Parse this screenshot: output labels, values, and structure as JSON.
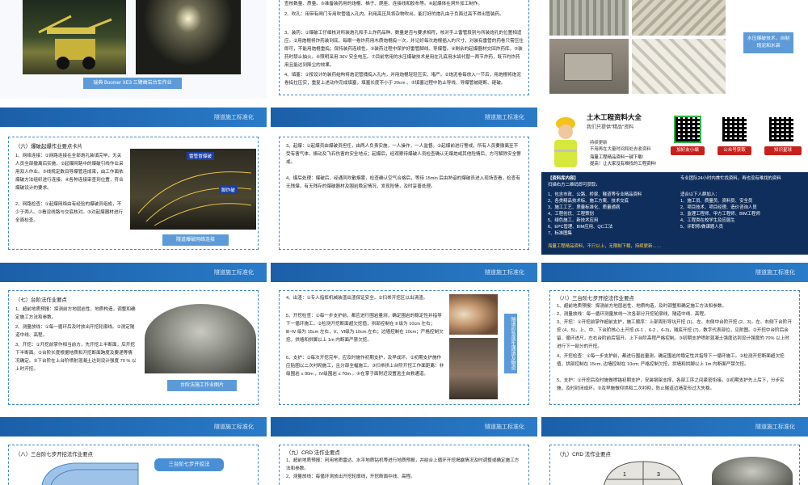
{
  "brand": "隧道施工标准化",
  "brand_short": "化",
  "row1": {
    "s1_caption": "瑞典 Boomer XE3 三臂凿岩台车作业",
    "s2_text": [
      "查核数量、质量。③准备装药用的炮棍、梯子、爬座、连接线和胶布等。④起爆体在洞外加工制作。",
      "2、吹孔：用带有闸门专用吹管插入孔内，利用高压风将杂物吹出，能打好的炮孔由于负面过高不得出管装药。",
      "3、装药：①爆破工仔细核对所装炮孔和手上炸药品种、数量是否与要求相符，核对手上雷管段别与所装炮孔的位置相适应。②用炮棍将炸药装到底，每眼一卷炸药用木质炮棍捣一次，并记好每次炮棍插入的尺寸，对装有雷管的药卷只需压住即可，不能用炮棍重捣；保持装药连续性。③装药过程中保护好雷管脚线、导爆管。④剩余的起爆器材交回炸药库。⑤装药时禁止抽火。⑥照明采用 36V 安全电压。⑦目前常用的水压爆破技术是用在孔底用水袋代替一两节炸药，既节约炸药用且能达到降尘的效果。",
      "4、填塞：①按设计的装药结构将炮泥管捅捣入孔内，并用炮棍轻轻压实、堵严。②炮泥卷每放入一节后，用炮棍将炮泥卷捣拉压实，重复上述动作完成填塞，填塞长度不小于 20cm 。③填塞过程中防止导线、导爆管被砸断、砸破。"
    ],
    "s3_side_caption": "水压爆破技术，自制炮泥和水袋"
  },
  "row2": {
    "s1_heading": "（六）爆破起爆作业要点卡片",
    "s1_text": [
      "1、网络连接：①网路连接在全部炮孔装填完毕，无关人员全部撤离后实施。②起爆网路中的爆破引线作业采用双人作业。③线规定数目导爆管连成束，由工作面依爆破方法组织进行连接。④各种连接审查到位置，符合爆破设计的要求。",
      "2、网路检查：①起爆网络由有经验的爆破员组成，不少于两人。②看设线路与交底核对。③对起爆器材进行全面检查。"
    ],
    "s1_photo_labels": [
      "雷管冒爆破",
      "脚炸破"
    ],
    "s1_caption": "隧道爆破网络连接",
    "s2_text": [
      "3、起爆：①起爆员由爆破员担任，由两人负责实施，一人操作，一人监督。②起爆前进行警戒，所有人员要撤离至不受有害气体、振动及飞石伤害的安全地点；起爆后，经观察待爆破人员检查确认无爆炮或其他险情后，方可解除安全警戒。",
      "4、爆后处理：爆破后，经通风吹散烟雾，检查确认空气合格后，等待 15min 后由熟谙的爆破员进入现场查看，检查有无残爆，有无残存的爆破器材及围岩稳定情况，发现险情，及时妥善处理。"
    ],
    "ad": {
      "title": "土木工程资料大全",
      "subtitle": "我们只提供\"精品\"资料",
      "lines": [
        "持续更新",
        "不用再在大量时间和处去收资料"
      ],
      "promo": [
        "海量工程精品资料一键下载!",
        "提高！让大家没有难找的工程资料!"
      ],
      "btns": [
        "立即扫码\n关注小编",
        "立即扫码\n领取资料",
        "立即扫码加入\n知识星球获取"
      ],
      "btn_sub": [
        "加好友小编",
        "公众号获取",
        "知识星球"
      ],
      "panel_left_title": "【资料库内容】",
      "panel_left_sub": "扫描右方二维码即可获取↓",
      "panel_left_items": [
        "1、包含市政、公路、桥梁、隧道等专业精品资料",
        "2、各类精品技术标、施工方案、技术交底",
        "3、施工工艺、质量标准化、质量通病",
        "4、工程创优、工程策划",
        "5、绿色施工、新技术应用",
        "6、EPC管理、BIM应用、QC工法",
        "7、标准图集"
      ],
      "panel_right_title": "专业团队24小时内首忙找资料，再也没有难找的资料",
      "panel_right_sub": "适合以下人群加入：",
      "panel_right_items": [
        "1、施工员、质量员、资料员、安全员",
        "2、项目技术、项目经理、造价咨询人员",
        "3、监理工程师、甲方工程师、BIM工程师",
        "4、工程类在校学生及应届生",
        "5、评职称/做课题人员"
      ],
      "footer": "海量工程精品资料，不只以上，无限制下载，持续更新……"
    }
  },
  "row3": {
    "s1_heading": "（七）台阶法作业要点",
    "s1_text": [
      "1、超前地质预报：探测前方地层岩性、地质构造，调整和确定施工方法和参数。",
      "2、测量放线：①每一循环后及时放出开挖轮廓线。②测定隧道中线、高程。",
      "3、开挖：①开挖前掌作相当前方，先开挖上半断面，后开挖下半断面。②台阶长度根据地质和开挖断面跨度及要递等情况确定。③下台阶在上台阶喷射混凝土达到设计强度 70 % 以上时开挖。"
    ],
    "s1_caption": "台阶法施工作业图片",
    "s2_text": [
      "4、出渣：①专人指挥机械装渣出渣保证安全。②扫帚开挖区以出清渣。",
      "5、开挖检查：①每一步支护前，都应进行围岩量测，确定围岩的稳定性并指导下一循环施工。②检测开挖断面超欠挖值，拱部控制在 Ⅱ 级为 10cm 左右；Ⅲ~Ⅳ 级为 15cm 左右，Ⅴ、Ⅵ级为 10cm 左右；边墙控制在 10cm；严格控制欠挖，拱墙和拱脚以上 1m 内断面严禁欠挖。",
      "6、支护：①每次开挖完毕，应及时施作初期支护，及早成环。②初期支护施作应贴圈以二次衬砌施工，且分部全幅施工。③扫帚拱上台阶开挖工作面距离：非级围岩 ≤ 90m ，Ⅳ级围岩 ≤ 70m 。④在掌子面附近设置逃生自救通道。"
    ],
    "s2_side_caption": "隧道应急逃生通道及物资",
    "s3_heading": "（八）三台阶七步开挖法作业要点",
    "s3_text": [
      "1、超前地质预报：探测前方地层岩性、地质构造，及时调整和确定施工方法和参数。",
      "2、测量放线：每一循环测量放线一次各部分开挖轮廓线、隧道中线、高程。",
      "3、开挖：①开挖前掌作超前支护，施工顺序：上部周形导坑开挖 (1)、左、右侧中台阶开挖 (2、3)，左、右侧下台阶开挖 (4、5)，上、中、下台阶核心土开挖 (6-1 、6-2 、6-3)，隧底开挖 (7)，数字代表部位，见附图。②开挖中台阶后余留、循环进尺，左右台阶前后错开。上下台阶高程严格控制。③初期支护喷射混凝土强度达到设计强度的 70% 以上时进行下一部分的开挖。",
      "4、开挖检查：①每一步支护前，都进行围岩量测，确定围岩的稳定性并指导下一循环施工。②检测开挖断面超欠挖值，拱部控制在 15cm, 边墙控制在 10cm; 严格控制欠挖，拱墙和拱脚以上 1m 内断面严禁欠挖。",
      "5、支护：①开挖后及时施做喷锚初期支护，安装钢架支撑，各部工序之间紧密衔接。②初期支护先上后下，分步实施，及时封闭成环。③及早施做仰拱和二次衬砌，防止隧道边墙变形过大失稳。"
    ]
  },
  "row4": {
    "s1_heading": "（八）三台阶七步开挖法作业要点",
    "s1_label": "三台阶七步开挖法",
    "s2_heading": "（九）CRD 法作业要点",
    "s2_text": [
      "1、超前地质预报：利用地质雷达、水平地质钻机等进行地质预报，并结合上循环开挖揭露情况及时调整或确定施工方法和参数。",
      "2、测量放线：每循环测放出开挖轮廓线，开挖断面中线、高程。"
    ],
    "s3_heading": "（九）CRD 法作业要点",
    "s3_numbers": [
      "1",
      "3"
    ]
  }
}
